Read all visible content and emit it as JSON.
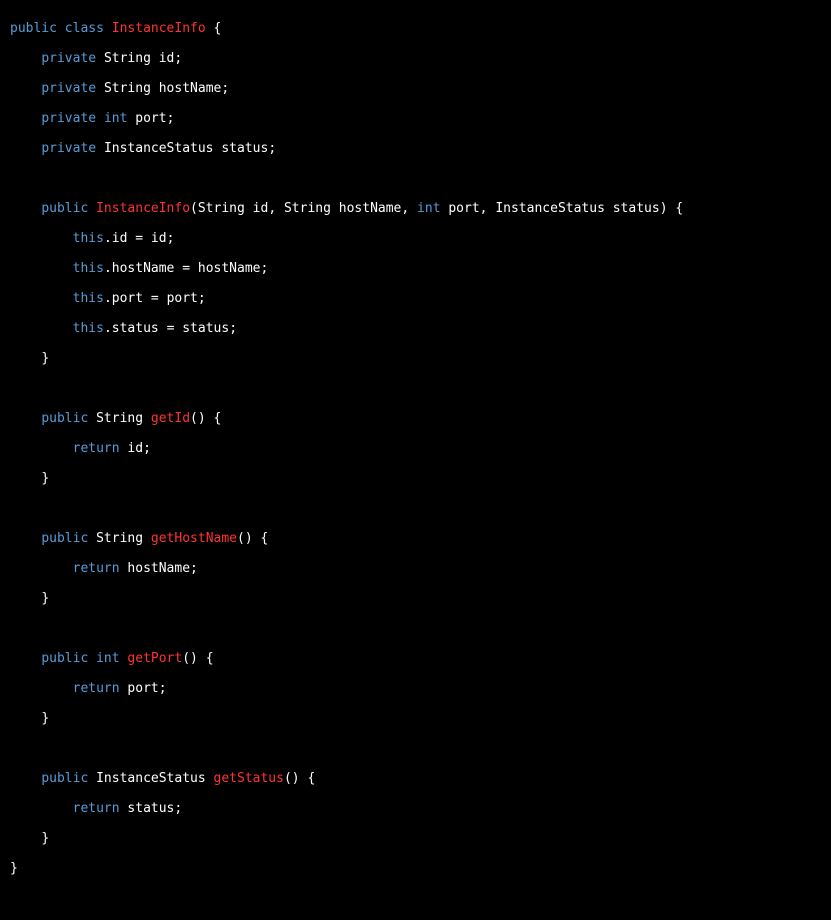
{
  "code": {
    "kw_public": "public",
    "kw_class": "class",
    "kw_private": "private",
    "kw_int": "int",
    "kw_return": "return",
    "kw_this": "this",
    "cls_name": "InstanceInfo",
    "ty_String": "String",
    "ty_InstanceStatus": "InstanceStatus",
    "f_id": "id",
    "f_hostName": "hostName",
    "f_port": "port",
    "f_status": "status",
    "m_getId": "getId",
    "m_getHostName": "getHostName",
    "m_getPort": "getPort",
    "m_getStatus": "getStatus",
    "sym_open": "{",
    "sym_close": "}",
    "sym_semi": ";",
    "sym_lparen": "(",
    "sym_rparen": ")",
    "sym_comma": ",",
    "sym_dot": ".",
    "sym_eq": "="
  }
}
